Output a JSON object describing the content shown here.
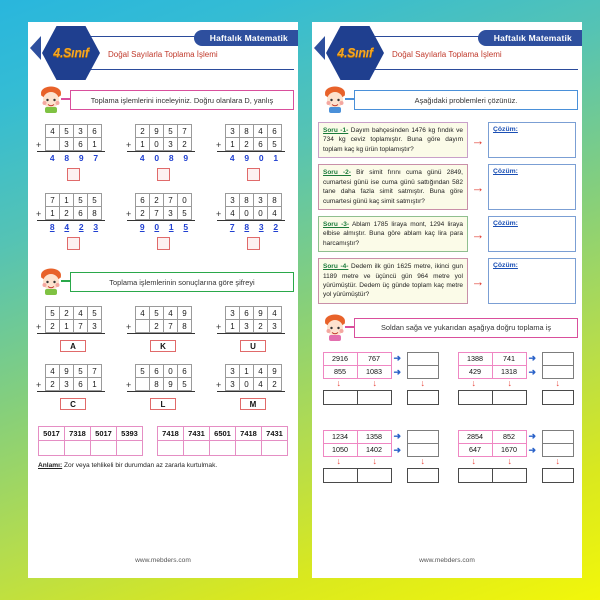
{
  "background": {
    "from": "#29b6dd",
    "to": "#f2f70a"
  },
  "header": {
    "grade_badge": "4.Sınıf",
    "ribbon": "Haftalık Matematik",
    "subject": "Doğal Sayılarla Toplama İşlemi"
  },
  "left_page": {
    "instruction1": "Toplama işlemlerini inceleyiniz. Doğru olanlara D, yanlış",
    "instruction1_bold": [
      "Toplama",
      "D"
    ],
    "addition_rows": [
      [
        {
          "top": [
            "4",
            "5",
            "3",
            "6"
          ],
          "bottom": [
            "",
            "3",
            "6",
            "1"
          ],
          "answer": [
            "4",
            "8",
            "9",
            "7"
          ]
        },
        {
          "top": [
            "2",
            "9",
            "5",
            "7"
          ],
          "bottom": [
            "1",
            "0",
            "3",
            "2"
          ],
          "answer": [
            "4",
            "0",
            "8",
            "9"
          ]
        },
        {
          "top": [
            "3",
            "8",
            "4",
            "6"
          ],
          "bottom": [
            "1",
            "2",
            "6",
            "5"
          ],
          "answer": [
            "4",
            "9",
            "0",
            "1"
          ]
        }
      ],
      [
        {
          "top": [
            "7",
            "1",
            "5",
            "5"
          ],
          "bottom": [
            "1",
            "2",
            "6",
            "8"
          ],
          "answer": [
            "8",
            "4",
            "2",
            "3"
          ]
        },
        {
          "top": [
            "6",
            "2",
            "7",
            "0"
          ],
          "bottom": [
            "2",
            "7",
            "3",
            "5"
          ],
          "answer": [
            "9",
            "0",
            "1",
            "5"
          ]
        },
        {
          "top": [
            "3",
            "8",
            "3",
            "8"
          ],
          "bottom": [
            "4",
            "0",
            "0",
            "4"
          ],
          "answer": [
            "7",
            "8",
            "3",
            "2"
          ]
        }
      ]
    ],
    "instruction2": "Toplama işlemlerinin sonuçlarına göre şifreyi",
    "instruction2_bold": [
      "Toplama",
      "sonuçlarına",
      "şifreyi"
    ],
    "cipher_rows": [
      [
        {
          "top": [
            "5",
            "2",
            "4",
            "5"
          ],
          "bottom": [
            "2",
            "1",
            "7",
            "3"
          ],
          "letter": "A"
        },
        {
          "top": [
            "4",
            "5",
            "4",
            "9"
          ],
          "bottom": [
            "",
            "2",
            "7",
            "8"
          ],
          "letter": "K"
        },
        {
          "top": [
            "3",
            "6",
            "9",
            "4"
          ],
          "bottom": [
            "1",
            "3",
            "2",
            "3"
          ],
          "letter": "U"
        }
      ],
      [
        {
          "top": [
            "4",
            "9",
            "5",
            "7"
          ],
          "bottom": [
            "2",
            "3",
            "6",
            "1"
          ],
          "letter": "C"
        },
        {
          "top": [
            "5",
            "6",
            "0",
            "6"
          ],
          "bottom": [
            "",
            "8",
            "9",
            "5"
          ],
          "letter": "L"
        },
        {
          "top": [
            "3",
            "1",
            "4",
            "9"
          ],
          "bottom": [
            "3",
            "0",
            "4",
            "2"
          ],
          "letter": "M"
        }
      ]
    ],
    "decoder": {
      "group1": [
        "5017",
        "7318",
        "5017",
        "5393"
      ],
      "group2": [
        "7418",
        "7431",
        "6501",
        "7418",
        "7431"
      ]
    },
    "meaning_label": "Anlamı:",
    "meaning_text": "Zor veya tehlikeli bir durumdan az zararla kurtulmak.",
    "footer": "www.mebders.com"
  },
  "right_page": {
    "instruction1": "Aşağıdaki problemleri çözünüz.",
    "instruction1_bold": [
      "problemleri"
    ],
    "questions": [
      {
        "no": "Soru -1-",
        "text": "Dayım bahçesinden 1476 kg fındık ve 734 kg ceviz toplamıştır. Buna göre dayım toplam kaç kg ürün toplamıştır?",
        "answer_label": "Çözüm:",
        "answer_value": ""
      },
      {
        "no": "Soru -2-",
        "text": "Bir simit fırını cuma günü 2849, cumartesi günü ise cuma günü sattığından 582 tane daha fazla simit satmıştır. Buna göre cumartesi günü kaç simit satmıştır?",
        "answer_label": "Çözüm:",
        "answer_value": ""
      },
      {
        "no": "Soru -3-",
        "text": "Ablam 1785 liraya mont, 1294 liraya elbise almıştır. Buna göre ablam kaç lira para harcamıştır?",
        "answer_label": "Çözüm:",
        "answer_value": ""
      },
      {
        "no": "Soru -4-",
        "text": "Dedem ilk gün 1625 metre, ikinci gun 1189 metre ve üçüncü gün 964 metre yol yürümüştür. Dedem üç günde toplam kaç metre yol yürümüştür?",
        "answer_label": "Çözüm:",
        "answer_value": ""
      }
    ],
    "instruction2": "Soldan sağa ve yukarıdan aşağıya doğru toplama iş",
    "instruction2_bold": [
      "Soldan",
      "yukarıdan",
      "toplama"
    ],
    "squares": [
      [
        {
          "cells": [
            [
              "2916",
              "767"
            ],
            [
              "855",
              "1083"
            ]
          ]
        },
        {
          "cells": [
            [
              "1388",
              "741"
            ],
            [
              "429",
              "1318"
            ]
          ]
        }
      ],
      [
        {
          "cells": [
            [
              "1234",
              "1358"
            ],
            [
              "1050",
              "1402"
            ]
          ]
        },
        {
          "cells": [
            [
              "2854",
              "852"
            ],
            [
              "647",
              "1670"
            ]
          ]
        }
      ]
    ],
    "footer": "www.mebders.com"
  },
  "icons": {
    "mascot": "child-mascot-icon",
    "arrow_right": "→",
    "arrow_down": "↓",
    "arrow_blue": "➔"
  }
}
